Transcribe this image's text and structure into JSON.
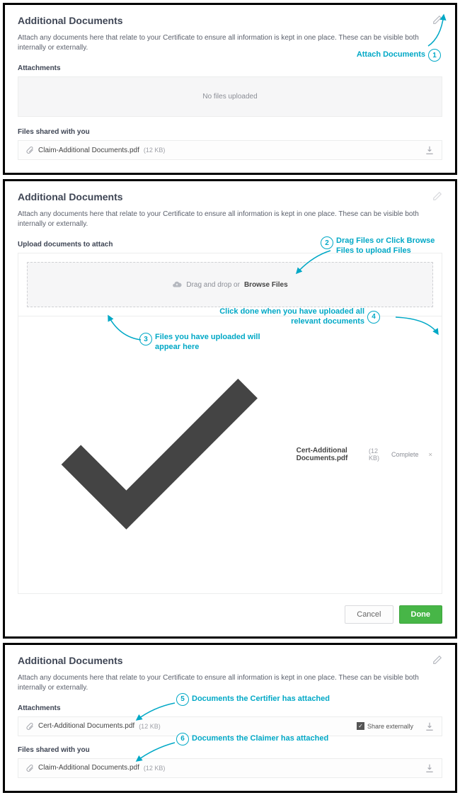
{
  "panel1": {
    "title": "Additional Documents",
    "desc": "Attach any documents here that relate to your Certificate to ensure all information is kept in one place. These can be visible both internally or externally.",
    "attachments_label": "Attachments",
    "empty_text": "No files uploaded",
    "shared_label": "Files shared with you",
    "shared_file_name": "Claim-Additional Documents.pdf",
    "shared_file_size": "(12 KB)",
    "anno1_label": "Attach Documents",
    "anno1_num": "1"
  },
  "panel2": {
    "title": "Additional Documents",
    "desc": "Attach any documents here that relate to your Certificate to ensure all information is kept in one place. These can be visible both internally or externally.",
    "upload_label": "Upload documents to attach",
    "drag_text": "Drag and drop  or ",
    "browse_text": "Browse Files",
    "uploaded_name": "Cert-Additional Documents.pdf",
    "uploaded_size": "(12 KB)",
    "complete_text": "Complete",
    "cancel_label": "Cancel",
    "done_label": "Done",
    "anno2_num": "2",
    "anno2_label": "Drag Files or Click Browse Files to upload Files",
    "anno3_num": "3",
    "anno3_label": "Files you have uploaded will appear here",
    "anno4_num": "4",
    "anno4_label": "Click done when you have uploaded all relevant documents"
  },
  "panel3": {
    "title": "Additional Documents",
    "desc": "Attach any documents here that relate to your Certificate to ensure all information is kept in one place. These can be visible both internally or externally.",
    "attachments_label": "Attachments",
    "cert_file_name": "Cert-Additional Documents.pdf",
    "cert_file_size": "(12 KB)",
    "share_ext_label": "Share externally",
    "shared_label": "Files shared with you",
    "shared_file_name": "Claim-Additional Documents.pdf",
    "shared_file_size": "(12 KB)",
    "anno5_num": "5",
    "anno5_label": "Documents the Certifier has attached",
    "anno6_num": "6",
    "anno6_label": "Documents the Claimer has attached"
  }
}
